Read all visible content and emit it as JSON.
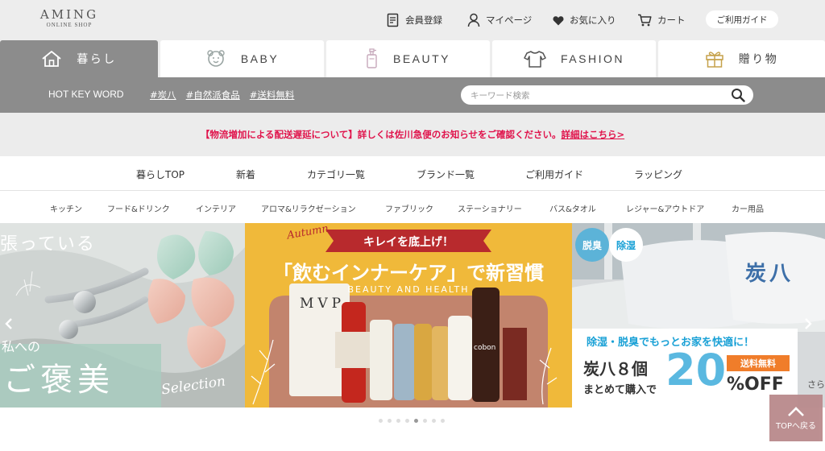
{
  "logo": {
    "main": "AMING",
    "sub": "ONLINE SHOP"
  },
  "header": {
    "register": "会員登録",
    "mypage": "マイページ",
    "favorites": "お気に入り",
    "cart": "カート",
    "guide": "ご利用ガイド"
  },
  "tabs": [
    {
      "label": "暮らし",
      "icon": "house-icon"
    },
    {
      "label": "BABY",
      "icon": "baby-icon"
    },
    {
      "label": "BEAUTY",
      "icon": "bottle-icon"
    },
    {
      "label": "FASHION",
      "icon": "shirt-icon"
    },
    {
      "label": "贈り物",
      "icon": "gift-icon"
    }
  ],
  "hotkey": {
    "title": "HOT KEY WORD",
    "tags": [
      "#炭八",
      "#自然派食品",
      "#送料無料"
    ]
  },
  "search": {
    "placeholder": "キーワード検索"
  },
  "notice": {
    "text": "【物流増加による配送遅延について】詳しくは佐川急便のお知らせをご確認ください。",
    "link": "詳細はこちら>"
  },
  "mainnav": [
    "暮らしTOP",
    "新着",
    "カテゴリ一覧",
    "ブランド一覧",
    "ご利用ガイド",
    "ラッピング"
  ],
  "subnav": [
    "キッチン",
    "フード&ドリンク",
    "インテリア",
    "アロマ&リラクゼーション",
    "ファブリック",
    "ステーショナリー",
    "バス&タオル",
    "レジャー&アウトドア",
    "カー用品"
  ],
  "banner1": {
    "top_text": "張っている",
    "sub_text": "私への",
    "title": "ご褒美",
    "script": "Selection"
  },
  "banner2": {
    "script": "Autumn",
    "ribbon": "キレイを底上げ！",
    "headline_a": "「飲むインナーケア」",
    "headline_b": "で新習慣",
    "sub": "BEAUTY AND HEALTH",
    "bag_label": "MVP",
    "bottle_label": "cobon"
  },
  "banner3": {
    "badge1": "脱臭",
    "badge2": "除湿",
    "bag_text": "炭八",
    "line1": "除湿・脱臭でもっとお家を快適に！",
    "line2": "炭八８個",
    "line3": "まとめて購入で",
    "percent": "20",
    "off": "%OFF",
    "free": "送料無料",
    "partial": "さら"
  },
  "slider": {
    "dots": 8,
    "active_index": 4
  },
  "totop": {
    "label": "TOPへ戻る"
  },
  "colors": {
    "accent_pink": "#e0144c",
    "tab_active": "#8c8c8c",
    "banner_blue": "#1aa1d6",
    "banner_orange": "#f0b93a"
  }
}
